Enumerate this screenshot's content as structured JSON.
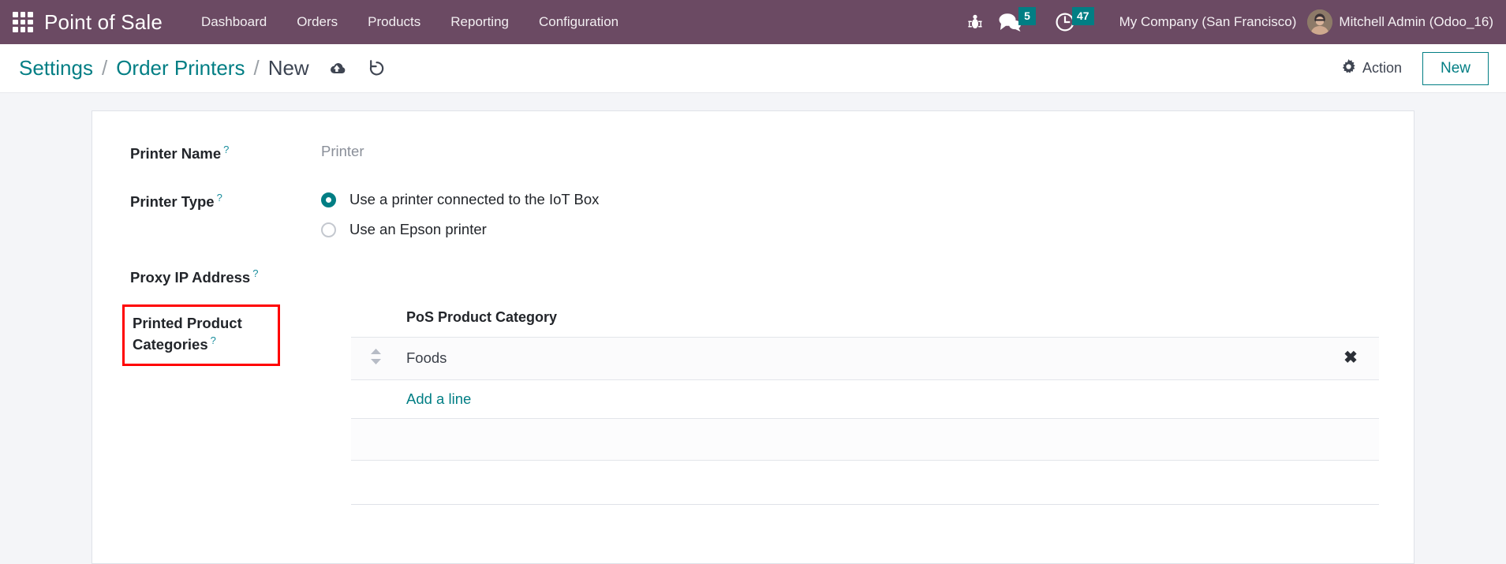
{
  "navbar": {
    "apps_icon": "apps-grid-icon",
    "brand": "Point of Sale",
    "menu": [
      {
        "label": "Dashboard"
      },
      {
        "label": "Orders"
      },
      {
        "label": "Products"
      },
      {
        "label": "Reporting"
      },
      {
        "label": "Configuration"
      }
    ],
    "bug_icon": "bug-icon",
    "messages": {
      "icon": "messages-icon",
      "count": "5"
    },
    "activities": {
      "icon": "clock-icon",
      "count": "47"
    },
    "company": "My Company (San Francisco)",
    "user": "Mitchell Admin (Odoo_16)",
    "avatar_icon": "user-avatar",
    "accent": "#017e84",
    "bg": "#6b4a63"
  },
  "control_panel": {
    "breadcrumb": [
      {
        "label": "Settings",
        "current": false
      },
      {
        "label": "Order Printers",
        "current": false
      },
      {
        "label": "New",
        "current": true
      }
    ],
    "separator": "/",
    "save_icon": "cloud-upload-save-icon",
    "discard_icon": "rotate-left-discard-icon",
    "action_label": "Action",
    "action_icon": "gear-icon",
    "new_label": "New"
  },
  "form": {
    "printer_name": {
      "label": "Printer Name",
      "tooltip_marker": "?",
      "placeholder": "Printer",
      "value": ""
    },
    "printer_type": {
      "label": "Printer Type",
      "tooltip_marker": "?",
      "options": [
        {
          "label": "Use a printer connected to the IoT Box",
          "selected": true
        },
        {
          "label": "Use an Epson printer",
          "selected": false
        }
      ]
    },
    "proxy_ip": {
      "label": "Proxy IP Address",
      "tooltip_marker": "?",
      "value": ""
    },
    "printed_categories": {
      "label_line1": "Printed Product",
      "label_line2": "Categories",
      "tooltip_marker": "?",
      "highlight_color": "#ff0000"
    }
  },
  "categories_table": {
    "columns": [
      "PoS Product Category"
    ],
    "handle_icon": "drag-handle-icon",
    "delete_icon": "delete-row-icon",
    "rows": [
      {
        "category": "Foods"
      }
    ],
    "add_line_label": "Add a line"
  }
}
